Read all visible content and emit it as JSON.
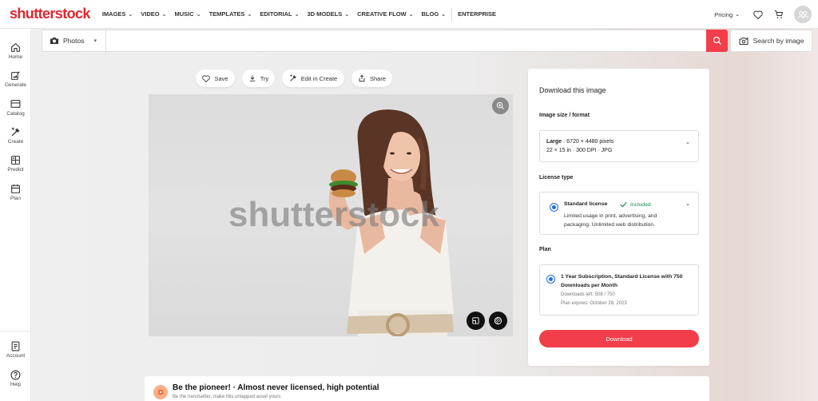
{
  "brand": {
    "logo_text": "shutterstock",
    "accent": "#f23d4a",
    "logo_color": "#e4262d"
  },
  "nav": {
    "items": [
      {
        "label": "IMAGES",
        "dropdown": true
      },
      {
        "label": "VIDEO",
        "dropdown": true
      },
      {
        "label": "MUSIC",
        "dropdown": true
      },
      {
        "label": "TEMPLATES",
        "dropdown": true
      },
      {
        "label": "EDITORIAL",
        "dropdown": true
      },
      {
        "label": "3D MODELS",
        "dropdown": true
      },
      {
        "label": "CREATIVE FLOW",
        "dropdown": true
      },
      {
        "label": "BLOG",
        "dropdown": true
      },
      {
        "label": "ENTERPRISE",
        "dropdown": false
      }
    ],
    "pricing_label": "Pricing",
    "chevron": "⌄",
    "icons": [
      "heart-icon",
      "cart-icon",
      "account-avatar-icon"
    ]
  },
  "rail": {
    "items": [
      {
        "label": "Home",
        "icon": "home-icon"
      },
      {
        "label": "Generate",
        "icon": "generate-icon"
      },
      {
        "label": "Catalog",
        "icon": "catalog-icon"
      },
      {
        "label": "Create",
        "icon": "create-icon"
      },
      {
        "label": "Predict",
        "icon": "predict-icon"
      },
      {
        "label": "Plan",
        "icon": "plan-icon"
      }
    ],
    "bottom_items": [
      {
        "label": "Account",
        "icon": "account-icon"
      },
      {
        "label": "Help",
        "icon": "help-icon"
      }
    ]
  },
  "search": {
    "media_type": "Photos",
    "placeholder": "",
    "value": "",
    "search_by_image_label": "Search by image"
  },
  "actions": {
    "save": "Save",
    "try": "Try",
    "edit_in_create": "Edit in Create",
    "share": "Share"
  },
  "image": {
    "watermark": "shutterstock"
  },
  "panel": {
    "title": "Download this image",
    "size_label": "Image size / format",
    "size_name": "Large",
    "size_pixels": "· 6720 × 4480 pixels",
    "size_details": "22 × 15 in · 300 DPI · JPG",
    "license_label": "License type",
    "license_name": "Standard license",
    "license_included": "Included",
    "license_desc": "Limited usage in print, advertising, and packaging. Unlimited web distribution.",
    "plan_label": "Plan",
    "plan_name": "1 Year Subscription, Standard License with 750 Downloads per Month",
    "downloads_left": "Downloads left: 508 / 750",
    "plan_expires": "Plan expires: October 28, 2023",
    "download_button": "Download",
    "included_color": "#0f8a4e",
    "radio_color": "#1e6ee8"
  },
  "pioneer": {
    "title": "Be the pioneer! · Almost never licensed, high potential",
    "subtitle": "Be the trendsetter, make this untapped asset yours"
  }
}
